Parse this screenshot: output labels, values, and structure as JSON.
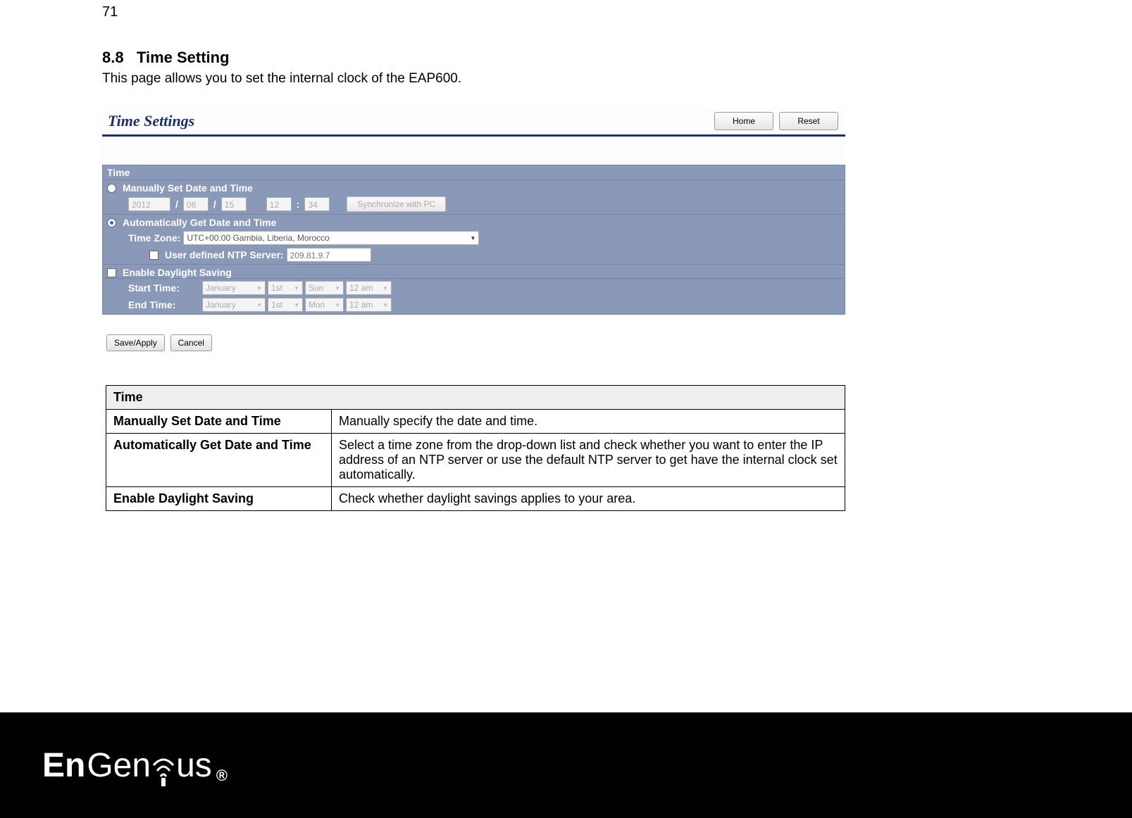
{
  "page": {
    "number": "71",
    "heading_num": "8.8",
    "heading_title": "Time Setting",
    "intro": "This page allows you to set the internal clock of the EAP600."
  },
  "panel": {
    "title": "Time Settings",
    "buttons": {
      "home": "Home",
      "reset": "Reset"
    },
    "section_label": "Time",
    "manual": {
      "label": "Manually Set Date and Time",
      "year": "2012",
      "month": "06",
      "day": "15",
      "hour": "12",
      "minute": "34",
      "sep": "/",
      "colon": ":",
      "sync_btn": "Synchronize with PC"
    },
    "auto": {
      "label": "Automatically Get Date and Time",
      "tz_label": "Time Zone:",
      "tz_value": "UTC+00:00 Gambia, Liberia, Morocco",
      "ntp_label": "User defined NTP Server:",
      "ntp_value": "209.81.9.7"
    },
    "dst": {
      "label": "Enable Daylight Saving",
      "start_label": "Start Time:",
      "end_label": "End Time:",
      "start": {
        "month": "January",
        "week": "1st",
        "day": "Sun",
        "hour": "12 am"
      },
      "end": {
        "month": "January",
        "week": "1st",
        "day": "Mon",
        "hour": "12 am"
      }
    },
    "footer": {
      "save": "Save/Apply",
      "cancel": "Cancel"
    }
  },
  "table": {
    "header": "Time",
    "rows": [
      {
        "k": "Manually Set Date and Time",
        "v": "Manually specify the date and time."
      },
      {
        "k": "Automatically Get Date and Time",
        "v": "Select a time zone from the drop-down list and check whether you want to enter the IP address of an NTP server or use the default NTP server to get have the internal clock set automatically."
      },
      {
        "k": "Enable Daylight Saving",
        "v": "Check whether daylight savings applies to your area."
      }
    ]
  },
  "brand": {
    "part1": "En",
    "part2": "Gen",
    "part3": "us",
    "reg": "®"
  }
}
